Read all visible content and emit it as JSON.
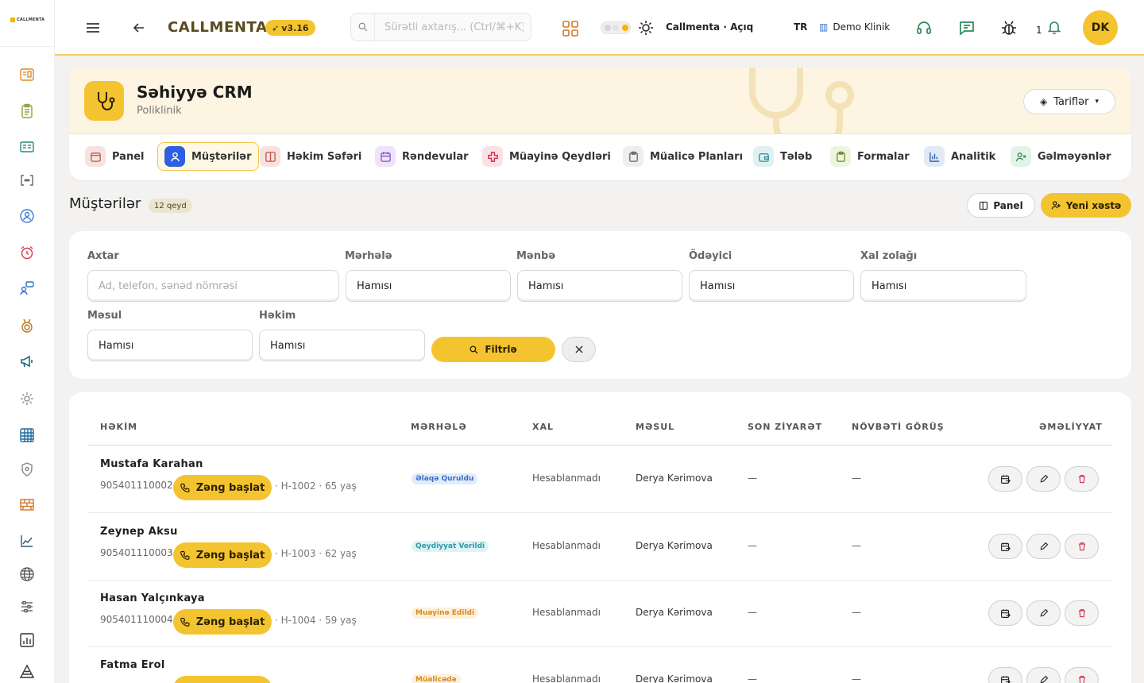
{
  "app": {
    "logo_text": "CALLMENTA",
    "brand": "CALLMENTA",
    "version": "v3.16",
    "search_placeholder": "Sürətli axtarış... (Ctrl/⌘+K)",
    "workspace_status": "Callmenta · Açıq",
    "language": "TR",
    "clinic": "Demo Klinik",
    "notification_count": "1",
    "avatar_initials": "DK"
  },
  "hero": {
    "title": "Səhiyyə CRM",
    "subtitle": "Poliklinik",
    "tariffs_label": "Tariflər"
  },
  "nav_tabs": [
    {
      "label": "Panel",
      "icon": "calendar-panel-icon",
      "color": "#f6e3df",
      "stroke": "#c0564a"
    },
    {
      "label": "Müştərilər",
      "icon": "user-icon",
      "color": "#2f5fe0",
      "stroke": "#ffffff",
      "active": true
    },
    {
      "label": "Həkim Səfəri",
      "icon": "columns-icon",
      "color": "#f8e1df",
      "stroke": "#c0564a"
    },
    {
      "label": "Rəndevular",
      "icon": "calendar-icon",
      "color": "#efe3fb",
      "stroke": "#8a4fd0"
    },
    {
      "label": "Müayinə Qeydləri",
      "icon": "medical-cross-icon",
      "color": "#fbe1e6",
      "stroke": "#d0304e"
    },
    {
      "label": "Müalicə Planları",
      "icon": "clipboard-icon",
      "color": "#eeeeee",
      "stroke": "#666666"
    },
    {
      "label": "Tələb",
      "icon": "wallet-icon",
      "color": "#dff1f3",
      "stroke": "#2c8a96"
    },
    {
      "label": "Formalar",
      "icon": "clipboard-check-icon",
      "color": "#eef5df",
      "stroke": "#6c8a2c"
    },
    {
      "label": "Analitik",
      "icon": "bar-chart-icon",
      "color": "#e2eaf7",
      "stroke": "#3a66b0"
    },
    {
      "label": "Gəlməyənlər",
      "icon": "user-x-icon",
      "color": "#e2f3e8",
      "stroke": "#2f8a55"
    }
  ],
  "section": {
    "title": "Müştərilər",
    "count_badge": "12 qeyd",
    "panel_button": "Panel",
    "new_patient_button": "Yeni xəstə"
  },
  "filters": {
    "search": {
      "label": "Axtar",
      "placeholder": "Ad, telefon, sənəd nömrəsi"
    },
    "stage": {
      "label": "Mərhələ",
      "value": "Hamısı"
    },
    "source": {
      "label": "Mənbə",
      "value": "Hamısı"
    },
    "payer": {
      "label": "Ödəyici",
      "value": "Hamısı"
    },
    "score_band": {
      "label": "Xal zolağı",
      "value": "Hamısı"
    },
    "owner": {
      "label": "Məsul",
      "value": "Hamısı"
    },
    "doctor": {
      "label": "Həkim",
      "value": "Hamısı"
    },
    "filter_button": "Filtrlə"
  },
  "table": {
    "headers": [
      "HƏKİM",
      "MƏRHƏLƏ",
      "XAL",
      "MƏSUL",
      "SON ZİYARƏT",
      "NÖVBƏTİ GÖRÜŞ",
      "ƏMƏLİYYAT"
    ],
    "call_button": "Zəng başlat",
    "rows": [
      {
        "name": "Mustafa Karahan",
        "phone": "905401110002",
        "meta": "· H-1002 · 65 yaş",
        "stage": "Əlaqə Quruldu",
        "stage_bg": "#e1ecfb",
        "stage_fg": "#3a6fc4",
        "score": "Hesablanmadı",
        "owner": "Derya Kərimova",
        "last_visit": "—",
        "next_visit": "—"
      },
      {
        "name": "Zeynep Aksu",
        "phone": "905401110003",
        "meta": "· H-1003 · 62 yaş",
        "stage": "Qeydiyyat Verildi",
        "stage_bg": "#ddf3f6",
        "stage_fg": "#2b9bab",
        "score": "Hesablanmadı",
        "owner": "Derya Kərimova",
        "last_visit": "—",
        "next_visit": "—"
      },
      {
        "name": "Hasan Yalçınkaya",
        "phone": "905401110004",
        "meta": "· H-1004 · 59 yaş",
        "stage": "Muayinə Edildi",
        "stage_bg": "#fdf0dc",
        "stage_fg": "#d98a1c",
        "score": "Hesablanmadı",
        "owner": "Derya Kərimova",
        "last_visit": "—",
        "next_visit": "—"
      },
      {
        "name": "Fatma Erol",
        "phone": "",
        "meta": "",
        "stage": "Müalicədə",
        "stage_bg": "#fdf0dc",
        "stage_fg": "#d98a1c",
        "score": "Hesablanmadı",
        "owner": "Derya Kərimova",
        "last_visit": "—",
        "next_visit": "—"
      }
    ]
  },
  "sidebar": {
    "icons": [
      "dashboard-icon",
      "clipboard-list-icon",
      "id-card-icon",
      "code-brackets-icon",
      "target-user-icon",
      "alarm-clock-icon",
      "chat-users-icon",
      "medal-icon",
      "megaphone-icon",
      "settings-gear-icon",
      "grid-calendar-icon",
      "shield-icon",
      "bricks-icon",
      "line-chart-icon",
      "globe-icon",
      "sliders-icon",
      "bar-report-icon",
      "warning-triangle-icon"
    ]
  },
  "colors": {
    "accent": "#f4c430",
    "brand_text": "#5a4a1e",
    "active_tab": "#2f5fe0"
  }
}
